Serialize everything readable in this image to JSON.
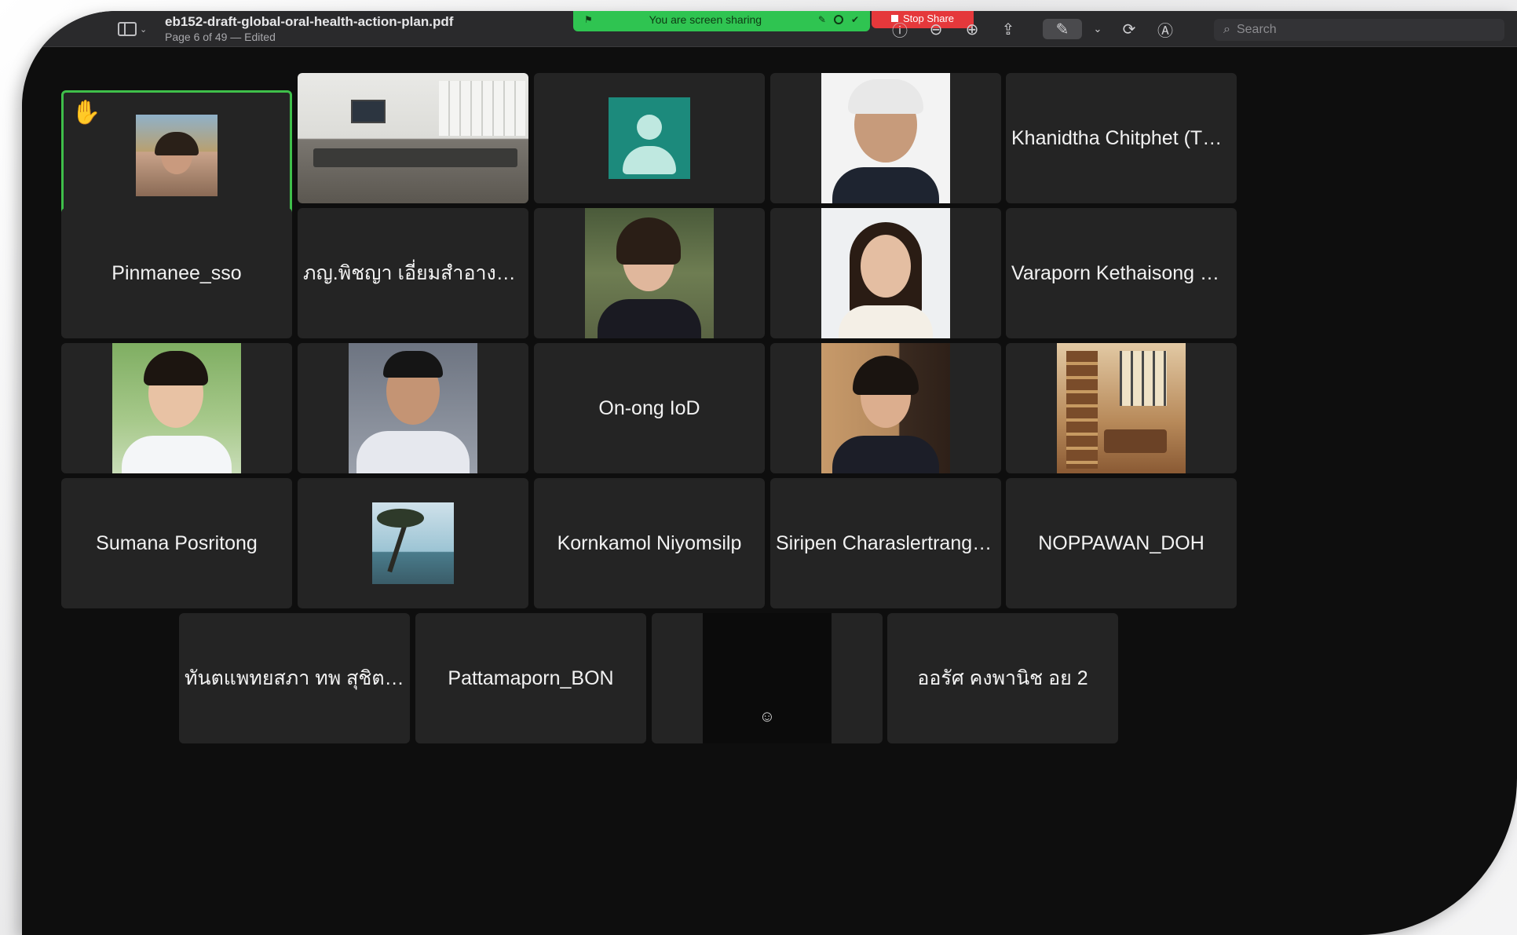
{
  "toolbar": {
    "document_title": "eb152-draft-global-oral-health-action-plan.pdf",
    "document_status": "Page 6 of 49 — Edited",
    "search_placeholder": "Search"
  },
  "share_banner": {
    "text": "You are screen sharing",
    "stop_label": "Stop Share",
    "banner_color": "#2fc451",
    "stop_color": "#e5383b"
  },
  "participants": {
    "names": [
      "Khanidtha Chitphet (Thai...",
      "Pinmanee_sso",
      "ภญ.พิชญา เอี่ยมสำอางค์...",
      "Varaporn Kethaisong กรม...",
      "On-ong IoD",
      "Sumana Posritong",
      "Kornkamol Niyomsilp",
      "Siripen Charaslertrangsi (...",
      "NOPPAWAN_DOH",
      "ทันตแพทยสภา ทพ สุชิต พูล...",
      "Pattamaporn_BON",
      "ออรัศ คงพานิช อย 2"
    ]
  },
  "icons": {
    "raised_hand": "raised-hand-icon",
    "reaction": "emoji-icon"
  }
}
